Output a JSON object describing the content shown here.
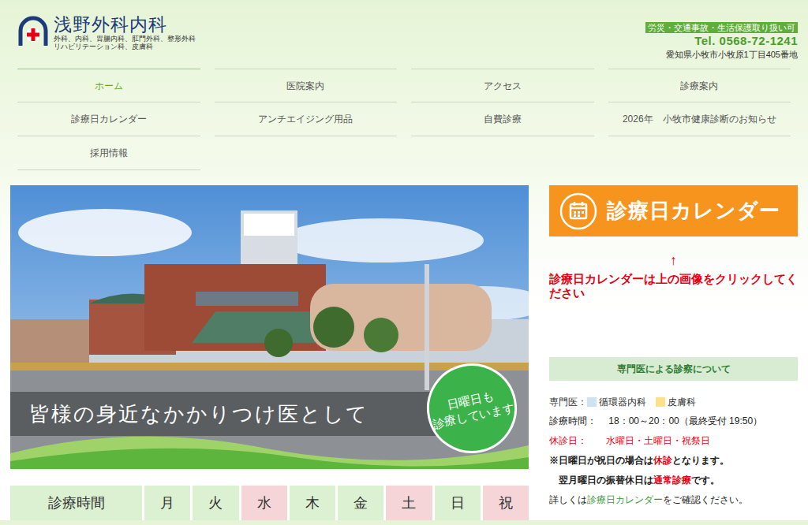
{
  "clinic": {
    "name": "浅野外科内科",
    "departments": [
      "外科、内科、胃腸内科、肛門外科、整形外科",
      "リハビリテーション科、皮膚科"
    ]
  },
  "header": {
    "badge": "労災・交通事故・生活保護取り扱い可",
    "tel": "Tel. 0568-72-1241",
    "address": "愛知県小牧市小牧原1丁目405番地"
  },
  "nav": [
    {
      "label": "ホーム",
      "selected": true
    },
    {
      "label": "医院案内",
      "selected": false
    },
    {
      "label": "アクセス",
      "selected": false
    },
    {
      "label": "診療案内",
      "selected": false
    },
    {
      "label": "診療日カレンダー",
      "selected": false
    },
    {
      "label": "アンチエイジング用品",
      "selected": false
    },
    {
      "label": "自費診療",
      "selected": false
    },
    {
      "label": "2026年　小牧市健康診断のお知らせ",
      "selected": false
    },
    {
      "label": "採用情報",
      "selected": false
    }
  ],
  "hero": {
    "caption": "皆様の身近なかかりつけ医として",
    "badge": [
      "日曜日も",
      "診療しています"
    ]
  },
  "hours_table": {
    "header": "診療時間",
    "days": [
      {
        "label": "月",
        "closed": false
      },
      {
        "label": "火",
        "closed": false
      },
      {
        "label": "水",
        "closed": true
      },
      {
        "label": "木",
        "closed": false
      },
      {
        "label": "金",
        "closed": false
      },
      {
        "label": "土",
        "closed": true
      },
      {
        "label": "日",
        "closed": false
      },
      {
        "label": "祝",
        "closed": true
      }
    ]
  },
  "sidebar": {
    "calendar_banner": "診療日カレンダー",
    "arrow": "↑",
    "notice": "診療日カレンダーは上の画像をクリックしてください",
    "specialist": {
      "title": "専門医による診察について",
      "label": "専門医：",
      "specialties": [
        {
          "name": "循環器内科",
          "color": "#cfe2f3"
        },
        {
          "name": "皮膚科",
          "color": "#ffe08a"
        }
      ],
      "lines": [
        {
          "bold": false,
          "segments": [
            {
              "text": "診療時間：　 18：00～20：00（最終受付 19:50）",
              "kind": "plain"
            }
          ]
        },
        {
          "bold": false,
          "segments": [
            {
              "text": "休診日：　　水曜日・土曜日・祝祭日",
              "kind": "red"
            }
          ]
        },
        {
          "bold": true,
          "segments": [
            {
              "text": "※日曜日が祝日の場合は",
              "kind": "plain"
            },
            {
              "text": "休診",
              "kind": "red"
            },
            {
              "text": "となります。",
              "kind": "plain"
            }
          ]
        },
        {
          "bold": true,
          "segments": [
            {
              "text": "　翌月曜日の振替休日は",
              "kind": "plain"
            },
            {
              "text": "通常診療",
              "kind": "red"
            },
            {
              "text": "です。",
              "kind": "plain"
            }
          ]
        },
        {
          "bold": false,
          "segments": [
            {
              "text": "詳しくは",
              "kind": "plain"
            },
            {
              "text": "診療日カレンダー",
              "kind": "link"
            },
            {
              "text": "をご確認ください。",
              "kind": "plain"
            }
          ]
        }
      ]
    }
  }
}
